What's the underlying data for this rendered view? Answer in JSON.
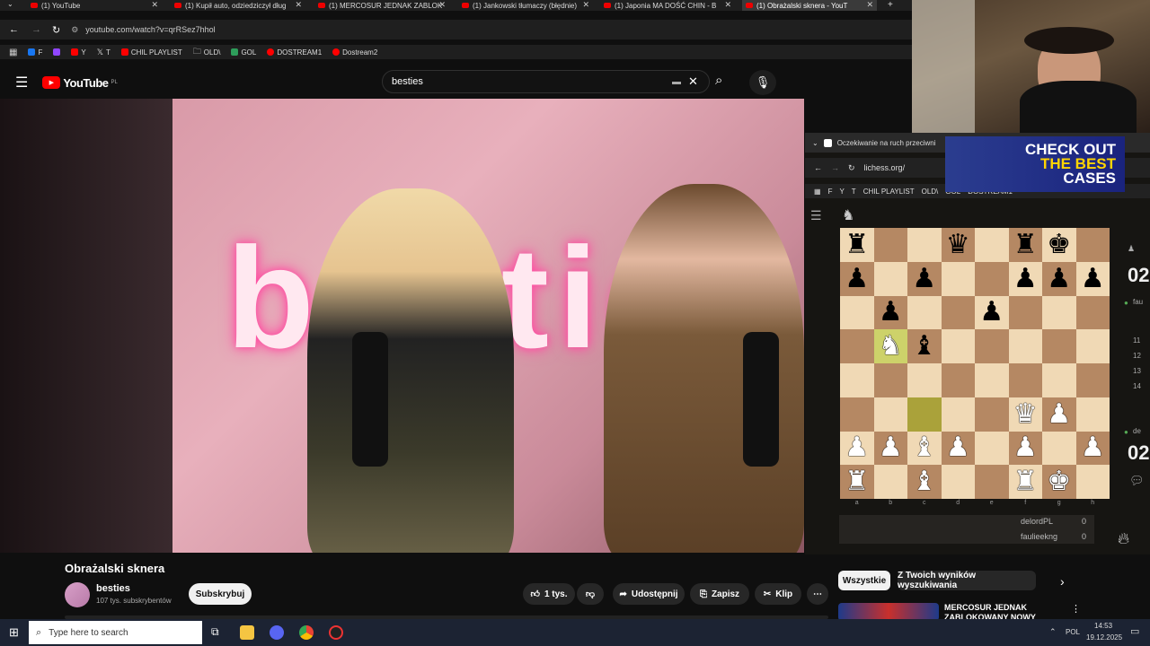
{
  "browser": {
    "tabs": [
      {
        "label": "(1) YouTube",
        "active": false
      },
      {
        "label": "(1) Kupił auto, odziedziczył dług",
        "active": false
      },
      {
        "label": "(1) MERCOSUR JEDNAK ZABLOK",
        "active": false
      },
      {
        "label": "(1) Jankowski tłumaczy (błędnie)",
        "active": false
      },
      {
        "label": "(1) Japonia MA DOŚĆ CHIN - B",
        "active": false
      },
      {
        "label": "(1) Obrażalski sknera - YouT",
        "active": true
      }
    ],
    "url": "youtube.com/watch?v=qrRSez7hhol",
    "bookmarks": [
      {
        "label": "F",
        "color": "#1877f2"
      },
      {
        "label": "",
        "color": "#9146ff"
      },
      {
        "label": "Y",
        "color": "#ff0000"
      },
      {
        "label": "T",
        "color": "#000000"
      },
      {
        "label": "CHIL PLAYLIST",
        "color": "#ff0000"
      },
      {
        "label": "OLD\\",
        "color": "#888888"
      },
      {
        "label": "GOL",
        "color": "#2e9e5b"
      },
      {
        "label": "DOSTREAM1",
        "color": "#ff0000"
      },
      {
        "label": "Dostream2",
        "color": "#ff0000"
      }
    ]
  },
  "youtube": {
    "logo": "YouTube",
    "region": "PL",
    "search_value": "besties",
    "video_title": "Obrażalski sknera",
    "channel_name": "besties",
    "subscribers": "107 tys. subskrybentów",
    "subscribe_label": "Subskrybuj",
    "likes": "1 tys.",
    "share_label": "Udostępnij",
    "save_label": "Zapisz",
    "clip_label": "Klip",
    "filter_all": "Wszystkie",
    "filter_search": "Z Twoich wyników wyszukiwania",
    "related_title": "MERCOSUR JEDNAK ZABLOKOWANY NOWY"
  },
  "neon_sign": "besties",
  "chess": {
    "window_title": "Oczekiwanie na ruch przeciwni",
    "url": "lichess.org/",
    "bookmarks": [
      "F",
      "Y",
      "T",
      "CHIL PLAYLIST",
      "OLD\\",
      "GOL",
      "DOSTREAM1"
    ],
    "board": [
      [
        "br",
        "",
        "",
        "bq",
        "",
        "br",
        "bk",
        ""
      ],
      [
        "bp",
        "",
        "bp",
        "",
        "",
        "bp",
        "bp",
        "bp"
      ],
      [
        "",
        "bp",
        "",
        "",
        "bp",
        "",
        "",
        ""
      ],
      [
        "",
        "wn",
        "bb",
        "",
        "",
        "",
        "",
        ""
      ],
      [
        "",
        "",
        "",
        "",
        "",
        "",
        "",
        ""
      ],
      [
        "",
        "",
        "",
        "",
        "",
        "wq",
        "wp",
        ""
      ],
      [
        "wp",
        "wp",
        "wb",
        "wp",
        "",
        "wp",
        "",
        "wp"
      ],
      [
        "wr",
        "",
        "wb",
        "",
        "",
        "wr",
        "wk",
        ""
      ]
    ],
    "highlights": [
      [
        3,
        1
      ],
      [
        5,
        2
      ]
    ],
    "files": [
      "a",
      "b",
      "c",
      "d",
      "e",
      "f",
      "g",
      "h"
    ],
    "players": [
      {
        "name": "delordPL",
        "score": "0"
      },
      {
        "name": "faulieekng",
        "score": "0"
      }
    ],
    "clock_top": "02",
    "clock_bottom": "02",
    "move_numbers": [
      "11",
      "12",
      "13",
      "14"
    ],
    "side_label_top": "fau",
    "side_label_bottom": "de"
  },
  "ad": {
    "line1": "CHECK OUT",
    "line2": "THE BEST",
    "line3": "CASES"
  },
  "taskbar": {
    "search_placeholder": "Type here to search",
    "language": "POL",
    "time": "14:53",
    "date": "19.12.2025"
  }
}
